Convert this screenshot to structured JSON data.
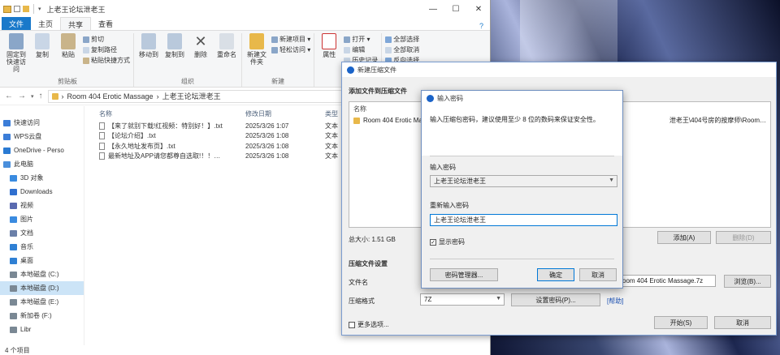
{
  "explorer": {
    "title": "上老王论坛泄老王",
    "tabs": [
      "文件",
      "主页",
      "共享",
      "查看"
    ],
    "ribbon": {
      "groups": [
        {
          "label": "剪贴板",
          "buttons": [
            "固定到快速访问",
            "复制",
            "粘贴"
          ],
          "small": [
            "剪切",
            "复制路径",
            "粘贴快捷方式"
          ]
        },
        {
          "label": "组织",
          "buttons": [
            "移动到",
            "复制到",
            "删除",
            "重命名"
          ]
        },
        {
          "label": "新建",
          "buttons": [
            "新建文件夹"
          ],
          "small": [
            "新建项目 ▾",
            "轻松访问 ▾"
          ]
        },
        {
          "label": "打开",
          "buttons": [
            "属性"
          ],
          "small": [
            "打开 ▾",
            "编辑",
            "历史记录"
          ]
        },
        {
          "label": "",
          "buttons": [],
          "small": [
            "全部选择",
            "全部取消",
            "反向选择"
          ]
        }
      ]
    },
    "address": {
      "path_root": "Room 404 Erotic Massage",
      "path_leaf": "上老王论坛泄老王",
      "sep": "›"
    },
    "sidebar": [
      {
        "label": "快速访问",
        "icon": "star-icon",
        "color": "#3b7dd8"
      },
      {
        "label": "WPS云盘",
        "icon": "cloud-icon",
        "color": "#3b7dd8"
      },
      {
        "label": "OneDrive - Perso",
        "icon": "cloud-icon",
        "color": "#2a7ad3"
      },
      {
        "label": "此电脑",
        "icon": "computer-icon",
        "color": "#4a8fdc"
      },
      {
        "label": "3D 对象",
        "icon": "cube-icon",
        "color": "#3a8be0"
      },
      {
        "label": "Downloads",
        "icon": "download-icon",
        "color": "#2f6fcf"
      },
      {
        "label": "视频",
        "icon": "video-icon",
        "color": "#5a6ab0"
      },
      {
        "label": "图片",
        "icon": "picture-icon",
        "color": "#3a8be0"
      },
      {
        "label": "文档",
        "icon": "document-icon",
        "color": "#6a7fa8"
      },
      {
        "label": "音乐",
        "icon": "music-icon",
        "color": "#2f80d4"
      },
      {
        "label": "桌面",
        "icon": "desktop-icon",
        "color": "#2f80d4"
      },
      {
        "label": "本地磁盘 (C:)",
        "icon": "drive-icon",
        "color": "#7a8894"
      },
      {
        "label": "本地磁盘 (D:)",
        "icon": "drive-icon",
        "color": "#7a8894"
      },
      {
        "label": "本地磁盘 (E:)",
        "icon": "drive-icon",
        "color": "#7a8894"
      },
      {
        "label": "新加卷 (F:)",
        "icon": "drive-icon",
        "color": "#7a8894"
      },
      {
        "label": "Libr",
        "icon": "drive-icon",
        "color": "#7a8894"
      }
    ],
    "columns": [
      "名称",
      "修改日期",
      "类型"
    ],
    "files": [
      {
        "name": "【来了就别下载!红视频：特别好！】.txt",
        "date": "2025/3/26 1:07",
        "type": "文本"
      },
      {
        "name": "【论坛介绍】.txt",
        "date": "2025/3/26 1:08",
        "type": "文本"
      },
      {
        "name": "【永久地址发布页】.txt",
        "date": "2025/3/26 1:08",
        "type": "文本"
      },
      {
        "name": "最新地址及APP请您都尊自选取!！！…",
        "date": "2025/3/26 1:08",
        "type": "文本"
      }
    ],
    "status": "4 个项目"
  },
  "archive_dialog": {
    "title": "新建压缩文件",
    "section_add": "添加文件到压缩文件",
    "list_header": "名称",
    "list_item": "Room 404 Erotic Massage",
    "list_item_tail": "泄老王\\404号房的按摩师\\Room…",
    "total_size": "总大小: 1.51 GB",
    "add_button": "添加(A)",
    "delete_button": "删除(D)",
    "section_settings": "压缩文件设置",
    "filename_label": "文件名",
    "filename_value": "oom 404 Erotic Massage.7z",
    "browse_button": "浏览(B)...",
    "format_label": "压缩格式",
    "format_value": "7Z",
    "settings_button": "设置密码(P)...",
    "help_link": "[帮助]",
    "more_options": "更多选项...",
    "start_button": "开始(S)",
    "cancel_button": "取消"
  },
  "password_dialog": {
    "title": "输入密码",
    "instruction": "输入压缩包密码，建议使用至少 8 位的数码来保证安全性。",
    "password_label": "输入密码",
    "password_value": "上老王论坛泄老王",
    "confirm_label": "重新输入密码",
    "confirm_value": "上老王论坛泄老王",
    "show_password": "显示密码",
    "manager_button": "密码管理器...",
    "ok_button": "确定",
    "cancel_button": "取消"
  }
}
